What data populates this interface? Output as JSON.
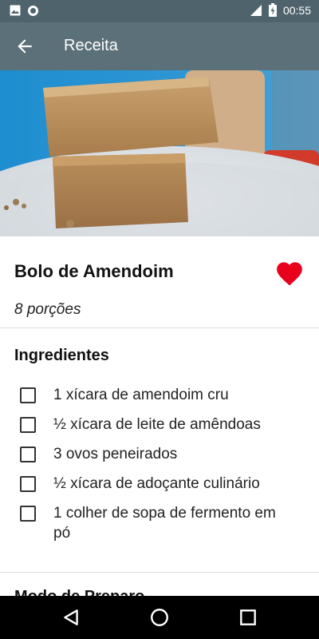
{
  "status_bar": {
    "time": "00:55",
    "icons": [
      "image-icon",
      "circle-icon",
      "signal-icon",
      "battery-charging-icon"
    ]
  },
  "app_bar": {
    "title": "Receita",
    "back_icon": "arrow-back-icon"
  },
  "recipe": {
    "title": "Bolo de Amendoim",
    "servings": "8 porções",
    "favorite": true,
    "favorite_color": "#e8001c"
  },
  "ingredients": {
    "heading": "Ingredientes",
    "items": [
      "1 xícara de amendoim cru",
      "½ xícara de leite de amêndoas",
      "3 ovos peneirados",
      "½ xícara de adoçante culinário",
      "1 colher de sopa de fermento em pó"
    ]
  },
  "preparation": {
    "heading": "Modo de Preparo"
  },
  "nav_bar": {
    "buttons": [
      "back-triangle-icon",
      "home-circle-icon",
      "recents-square-icon"
    ]
  },
  "colors": {
    "status_bar": "#4f636c",
    "app_bar": "#5b7078",
    "nav_bar": "#000000"
  }
}
